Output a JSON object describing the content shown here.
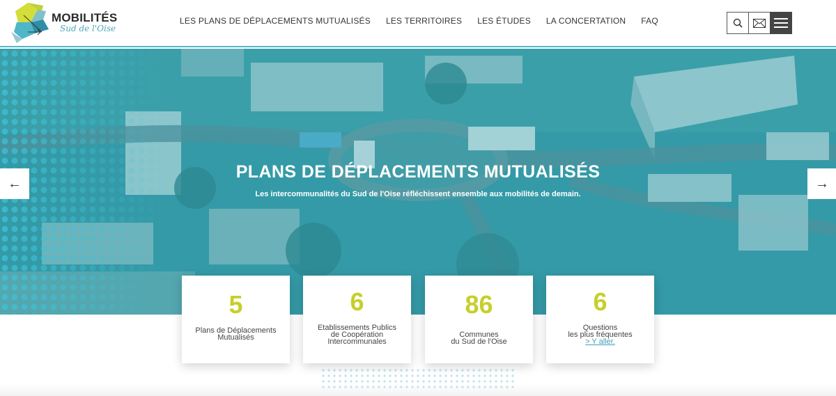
{
  "brand": {
    "title": "MOBILITÉS",
    "subtitle": "Sud de l'Oise"
  },
  "nav": [
    "LES PLANS DE DÉPLACEMENTS MUTUALISÉS",
    "LES TERRITOIRES",
    "LES ÉTUDES",
    "LA CONCERTATION",
    "FAQ"
  ],
  "icons": {
    "search": "search-icon",
    "mail": "mail-icon",
    "menu": "hamburger-icon"
  },
  "hero": {
    "title": "PLANS DE DÉPLACEMENTS MUTUALISÉS",
    "subtitle": "Les intercommunalités du Sud de l'Oise réfléchissent ensemble aux mobilités de demain.",
    "prev": "←",
    "next": "→"
  },
  "stats": [
    {
      "number": "5",
      "lines": [
        "Plans de Déplacements",
        "Mutualisés"
      ]
    },
    {
      "number": "6",
      "lines": [
        "Etablissements Publics",
        "de Coopération",
        "Intercommunales"
      ]
    },
    {
      "number": "86",
      "lines": [
        "Communes",
        "du Sud de l'Oise"
      ]
    },
    {
      "number": "6",
      "lines": [
        "Questions",
        "les plus fréquentes"
      ],
      "link": "> Y aller."
    }
  ],
  "colors": {
    "accent": "#c6cf2a",
    "teal": "#4fb5c9",
    "link": "#3a9fb5"
  }
}
